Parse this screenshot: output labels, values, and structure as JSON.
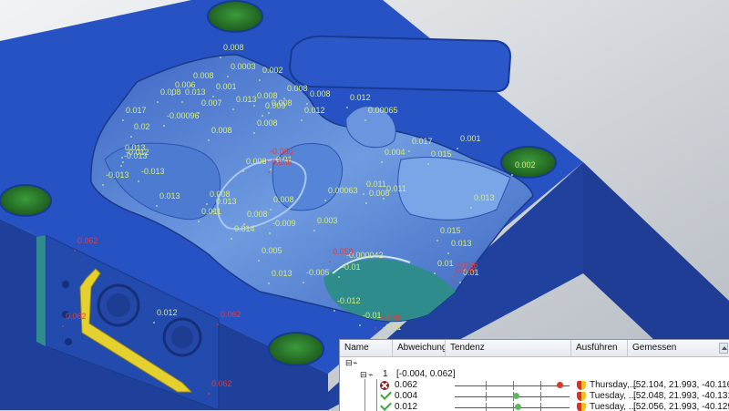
{
  "deviations": {
    "green": [
      "0.008",
      "0.0003",
      "0.002",
      "0.008",
      "0.006",
      "0.013",
      "0.001",
      "0.008",
      "0.008",
      "0.008",
      "0.007",
      "0.013",
      "0.008",
      "0.008",
      "0.012",
      "0.017",
      "-0.00096",
      "0.009",
      "0.012",
      "0.00065",
      "0.02",
      "0.008",
      "-0.013",
      "0.017",
      "0.001",
      "0.008",
      "0.015",
      "0.013",
      "0.004",
      "0.002",
      "-0.013",
      "0.008",
      "0.00063",
      "-0.013",
      "0.013",
      "0.013",
      "0.008",
      "0.011",
      "0.008",
      "0.013",
      "0.014",
      "-0.009",
      "0.003",
      "0.005",
      "-0.000042",
      "0.015",
      "0.013",
      "0.01",
      "-0.01",
      "0.01",
      "-0.005",
      "0.011",
      "-0.012",
      "0.012",
      "-0.01",
      "-0.01",
      "-0.012",
      "0.011",
      "0.008",
      "-0.01",
      "0.008",
      "0.013"
    ],
    "red": [
      "0.062",
      "0.062",
      "0.062",
      "0.062",
      "-0.066",
      "0.066",
      "0.058",
      "0.056",
      "-0.068",
      "0.058"
    ]
  },
  "results_panel": {
    "columns": {
      "name": "Name",
      "deviation": "Abweichung",
      "trend": "Tendenz",
      "execute": "Ausführen",
      "measured": "Gemessen"
    },
    "group_label": "1",
    "group_range": "[-0.004, 0.062]",
    "rows": [
      {
        "deviation": "0.062",
        "status": "fail",
        "executed": "Thursday,...",
        "measured": "[52.104, 21.993, -40.116]",
        "trend_color": "#d93b2b"
      },
      {
        "deviation": "0.004",
        "status": "pass",
        "executed": "Tuesday, ...",
        "measured": "[52.048, 21.993, -40.131]",
        "trend_color": "#5cb85c"
      },
      {
        "deviation": "0.012",
        "status": "pass",
        "executed": "Tuesday, ...",
        "measured": "[52.056, 21.993, -40.129]",
        "trend_color": "#5cb85c"
      }
    ]
  },
  "colors": {
    "part_top": "#2752c4",
    "part_side": "#1e3f9a",
    "pocket": "#5f8ed6",
    "hole": "#2c7d2c",
    "teal_face": "#2e8c8c",
    "fixture_yellow": "#e4d12f",
    "deviation_ok": "#d6ec7a",
    "deviation_fail": "#e8393a"
  }
}
